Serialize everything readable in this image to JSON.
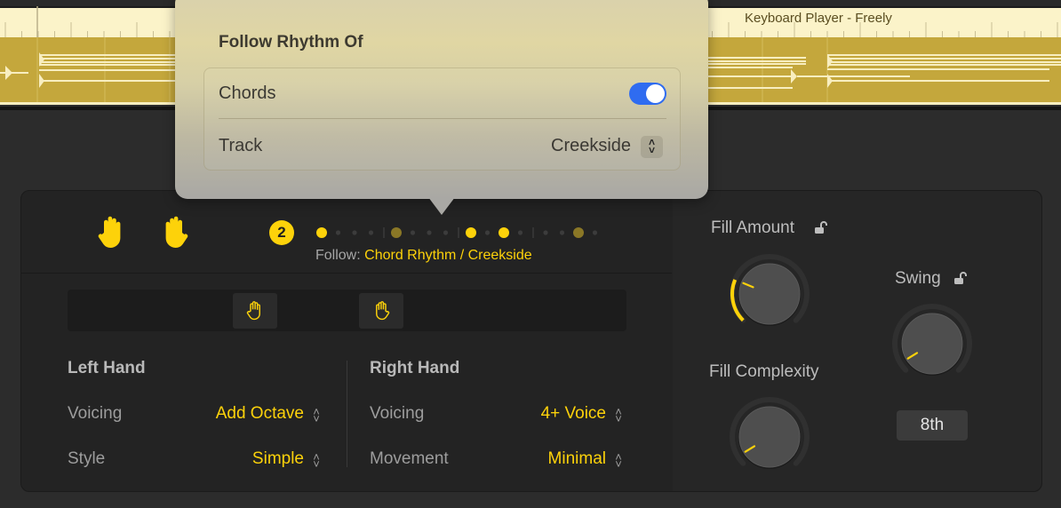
{
  "track": {
    "region_title": "Keyboard Player - Freely",
    "colors": {
      "ruler": "#fbf3c9",
      "body": "#c4a73c",
      "notes": "#f8eec0"
    }
  },
  "popover": {
    "title": "Follow Rhythm Of",
    "chords_label": "Chords",
    "chords_enabled": true,
    "track_label": "Track",
    "track_value": "Creekside"
  },
  "header": {
    "left_hand_icon": "hand-raised-icon",
    "right_hand_icon": "hand-raised-icon",
    "pattern_badge": "2",
    "pattern_steps": [
      {
        "kind": "large",
        "color": "bright"
      },
      {
        "kind": "small"
      },
      {
        "kind": "small"
      },
      {
        "kind": "small"
      },
      {
        "kind": "bar"
      },
      {
        "kind": "large",
        "color": "dim"
      },
      {
        "kind": "small"
      },
      {
        "kind": "small"
      },
      {
        "kind": "small"
      },
      {
        "kind": "bar"
      },
      {
        "kind": "large",
        "color": "bright"
      },
      {
        "kind": "small"
      },
      {
        "kind": "large",
        "color": "bright"
      },
      {
        "kind": "small"
      },
      {
        "kind": "bar"
      },
      {
        "kind": "small"
      },
      {
        "kind": "small"
      },
      {
        "kind": "large",
        "color": "dim"
      },
      {
        "kind": "small"
      }
    ],
    "follow_label": "Follow:",
    "follow_value": "Chord Rhythm / Creekside"
  },
  "hand_strip": {
    "left_hand_button_icon": "hand-outline-icon",
    "right_hand_button_icon": "hand-outline-icon"
  },
  "left_hand": {
    "title": "Left Hand",
    "rows": [
      {
        "label": "Voicing",
        "value": "Add Octave"
      },
      {
        "label": "Style",
        "value": "Simple"
      }
    ]
  },
  "right_hand": {
    "title": "Right Hand",
    "rows": [
      {
        "label": "Voicing",
        "value": "4+ Voice"
      },
      {
        "label": "Movement",
        "value": "Minimal"
      }
    ]
  },
  "knobs": {
    "fill_amount": {
      "label": "Fill Amount",
      "value_fraction": 0.25,
      "locked": false
    },
    "fill_complexity": {
      "label": "Fill Complexity",
      "value_fraction": 0.05,
      "locked": null
    },
    "swing": {
      "label": "Swing",
      "value_fraction": 0.05,
      "locked": false,
      "resolution": "8th"
    }
  },
  "colors": {
    "accent": "#fdd20a",
    "toggle_on": "#2f6cf0",
    "panel_bg": "#232323"
  }
}
